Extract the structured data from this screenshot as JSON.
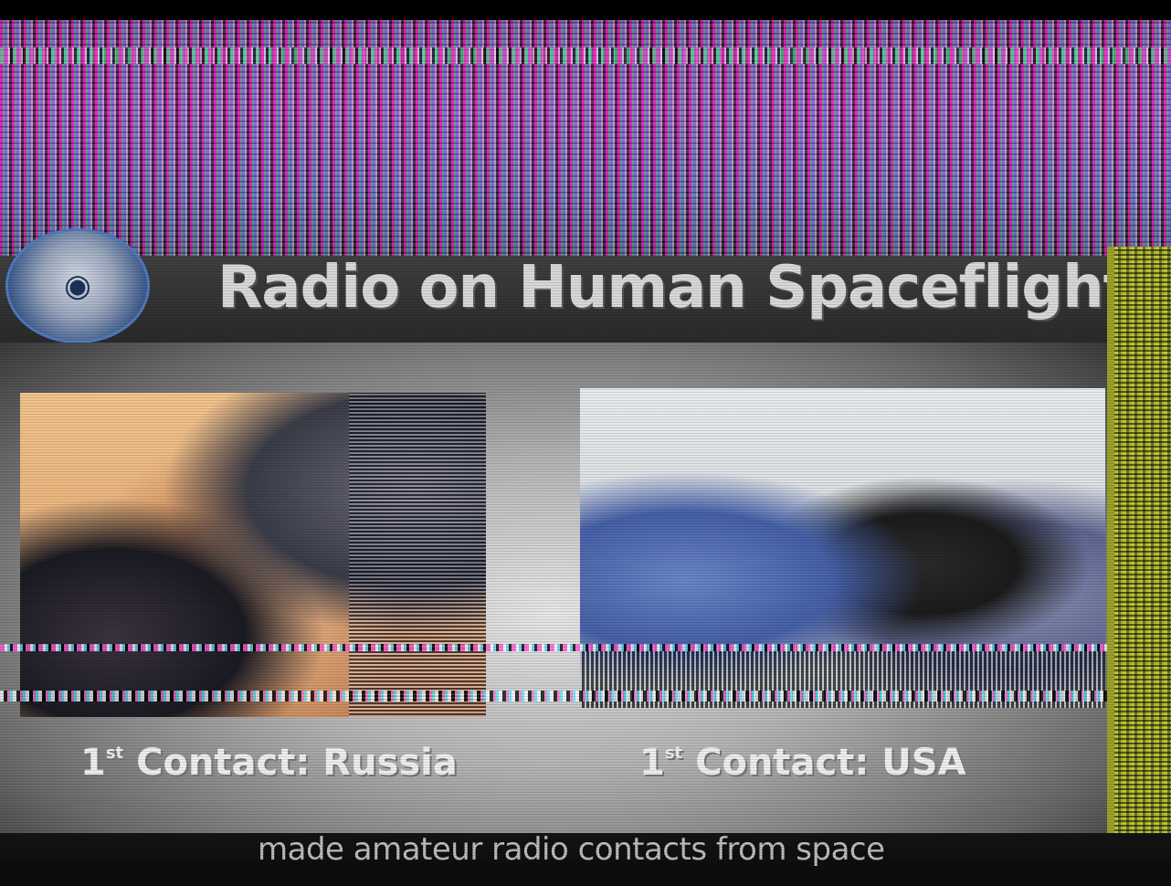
{
  "header": {
    "title": "Radio on Human Spaceflight"
  },
  "photos": {
    "left_caption_ordinal": "1",
    "left_caption_ordinal_suffix": "st",
    "left_caption_text": "Contact: Russia",
    "right_caption_ordinal": "1",
    "right_caption_ordinal_suffix": "st",
    "right_caption_text": "Contact: USA"
  },
  "footer": {
    "subtitle": "made amateur radio contacts from space"
  }
}
